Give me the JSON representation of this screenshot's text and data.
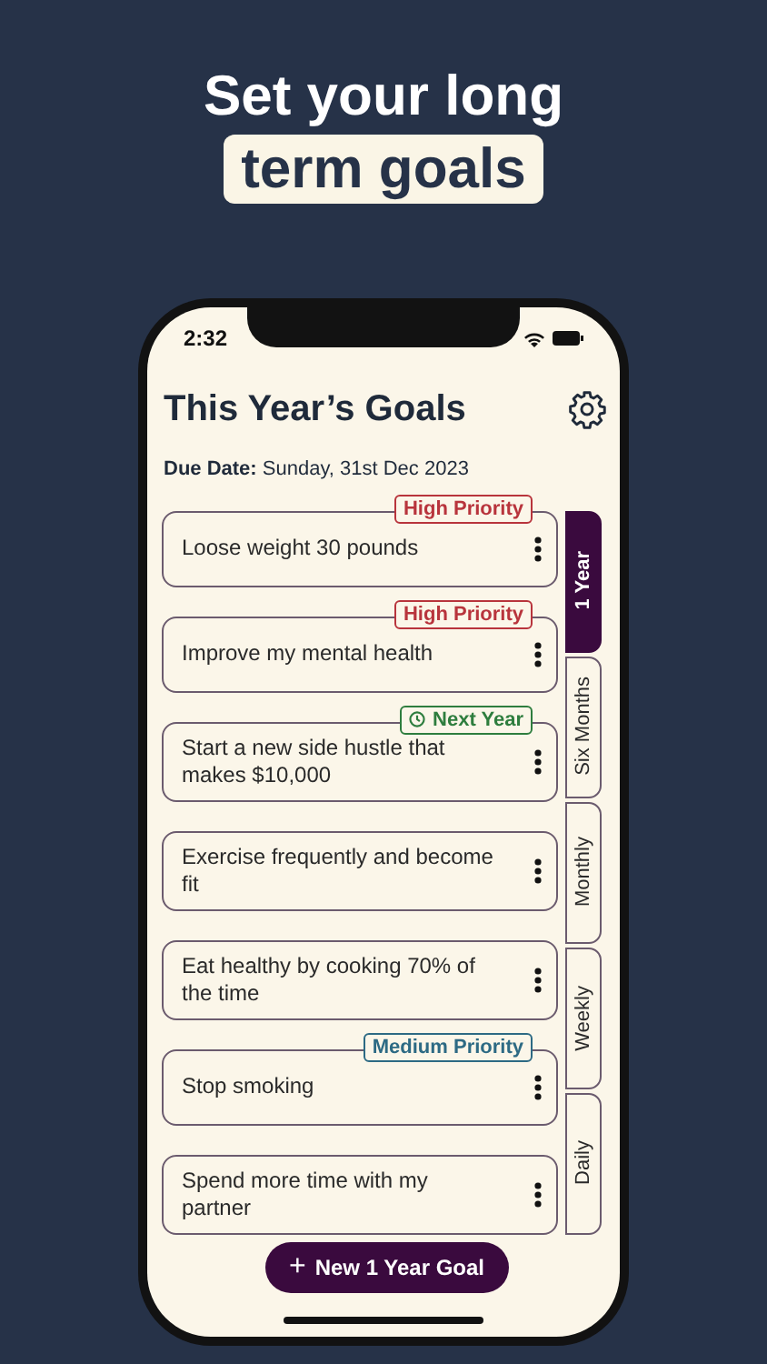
{
  "headline": {
    "line_1": "Set your long",
    "line_2": "term goals"
  },
  "status_bar": {
    "time": "2:32"
  },
  "screen": {
    "title": "This Year’s Goals",
    "due_label": "Due Date:",
    "due_value": "Sunday, 31st Dec 2023"
  },
  "goals": [
    {
      "text": "Loose weight 30 pounds",
      "tag": {
        "kind": "priority",
        "label": "High Priority",
        "color": "#b8343c"
      }
    },
    {
      "text": "Improve my mental health",
      "tag": {
        "kind": "priority",
        "label": "High Priority",
        "color": "#b8343c"
      }
    },
    {
      "text": "Start a new side hustle that makes $10,000",
      "tag": {
        "kind": "deadline",
        "label": "Next Year",
        "color": "#2e7d3e"
      }
    },
    {
      "text": "Exercise frequently and become fit"
    },
    {
      "text": "Eat healthy by cooking 70% of the time"
    },
    {
      "text": "Stop smoking",
      "tag": {
        "kind": "priority",
        "label": "Medium Priority",
        "color": "#2d6a84"
      }
    },
    {
      "text": "Spend more time with my partner"
    }
  ],
  "tabs": [
    {
      "label": "1 Year",
      "selected": true
    },
    {
      "label": "Six Months",
      "selected": false
    },
    {
      "label": "Monthly",
      "selected": false
    },
    {
      "label": "Weekly",
      "selected": false
    },
    {
      "label": "Daily",
      "selected": false
    }
  ],
  "fab": {
    "icon": "+",
    "label": "New 1 Year Goal"
  }
}
